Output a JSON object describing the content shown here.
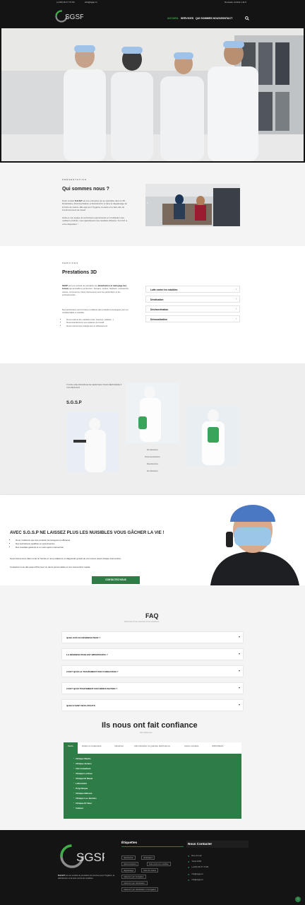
{
  "topbar": {
    "phone": "(+216) 29 17 70 00",
    "email": "info@sgsp.tn",
    "button": "Nouveau contrat 1 ali 3"
  },
  "header": {
    "logo": "SGSP",
    "nav": [
      "ACCUEIL",
      "SERVICES",
      "QUI SOMMES NOUS ?",
      "CONTACT"
    ],
    "active_color": "#3fae49"
  },
  "presentation": {
    "kicker": "PRÉSENTATION",
    "title": "Qui sommes nous ?",
    "p1_a": "Notre société ",
    "p1_b": "S.G.S.P",
    "p1_c": " est une entreprise qui se spécialise dans le 3D : Dératisation, Désinsectisation et Désinfection et dans le dégraissage de la hotte de cuisine. Elle agit pour l'hygiène, la santé et le bien-être de l'environnement de travail.",
    "p2": "Grâce à une équipe de techniciens expérimentés et à l'utilisation des meilleurs produits, nous garantissons des résultats efficaces. S.G.S.P. à votre disposition !"
  },
  "prestations": {
    "kicker": "SERVICES",
    "title": "Prestations 3D",
    "p1_a": "SGSP",
    "p1_b": " est une société de prestation de ",
    "p1_c": "désinfection et nettoyage des locaux",
    "p1_d": " qui accueille le personnel : bureaux, écoles, hôpitaux, restaurants, usines, commerces. Nous intervenons pour les particuliers et les professionnels.",
    "p2": "Nos techniciens sont formés et utilisent des produits homologués pour un résultat fiable et durable.",
    "bullets": [
      "Nous traitons les nuisibles (rats, insectes, cafards...)",
      "Nous désinfectons vos espaces de travail",
      "Nous intervenons rapidement et efficacement"
    ],
    "accordion": [
      "Lutte contre les nuisibles",
      "Dératisation",
      "Désinsectisation",
      "Démoustication"
    ]
  },
  "services3d": {
    "kicker": "TOUTE UNE PANOPLIE DE SERVICES POUR RÉPONDRE À VOS BESOINS",
    "title": "S.G.S.P",
    "list": [
      "Dératisation",
      "Désinsectisation",
      "Désinfection",
      "Dératisation"
    ]
  },
  "cta": {
    "title": "AVEC S.G.S.P NE LAISSEZ PLUS LES NUISIBLES VOUS GÂCHER LA VIE !",
    "bullets": [
      "Nous n'utilisons que des produits homologués et efficaces",
      "Des techniciens qualifiés et expérimentés",
      "Des résultats garantis et un suivi après intervention"
    ],
    "p1": "Nous intervenons dans toute la Tunisie et nous réalisons un diagnostic gratuit de vos locaux avant chaque intervention.",
    "p2": "Contactez-nous dès aujourd'hui pour un devis personnalisé et une intervention rapide.",
    "button": "CONTACTEZ NOUS"
  },
  "faq": {
    "title": "FAQ",
    "subtitle": "Retrouvez ici les réponses à vos questions",
    "items": [
      "QUEL EST-CE DÉSINFECTEUR ?",
      "LA DÉSINFECTION EST IMPORTANTE ?",
      "C'EST QUOI LE TRAITEMENT PAR FUMIGATION ?",
      "C'EST QUOI TRAITEMENT PAR NÉBULISATION ?",
      "QUELS SONT NOS ATOUTS"
    ]
  },
  "clients": {
    "title": "Ils nous ont fait confiance",
    "subtitle": "Nos références",
    "tabs": [
      "Santé",
      "Hôtels et restaurants",
      "Industries",
      "Administration et grandes distributions",
      "Autres sociétés",
      "ANNASEAA"
    ],
    "active_tab_color": "#2e7d46",
    "references": [
      "Clinique Mantis",
      "Clinique Amiens",
      "Cité mutualisée",
      "Clinique La Rose",
      "Clinique El Manar",
      "Laboratoire",
      "Polyclinique",
      "Clinique Nafoura",
      "Clinique Les Jasmins",
      "Clinique Dr Nour",
      "Cabinet"
    ]
  },
  "footer": {
    "logo": "SGSP",
    "about_a": "S.G.S.P",
    "about_b": " est une société de prestation de services pour l'hygiène, la désinfection et la lutte contre les nuisibles.",
    "tags_title": "Étiquettes",
    "tags": [
      "désinfection",
      "dératisation",
      "désinsectisation",
      "lutte contre les nuisibles",
      "dégraissage",
      "hotte de cuisine",
      "traitement par fumigation",
      "traitement par nébulisation",
      "traitement par nébulisation et fumigation"
    ],
    "contact_title": "Nous Contacter",
    "contact": [
      "Rue du Lac",
      "Tunis 1053",
      "(+216) 29 17 70 00",
      "info@sgsp.tn",
      "info@sgsp.tn"
    ]
  }
}
